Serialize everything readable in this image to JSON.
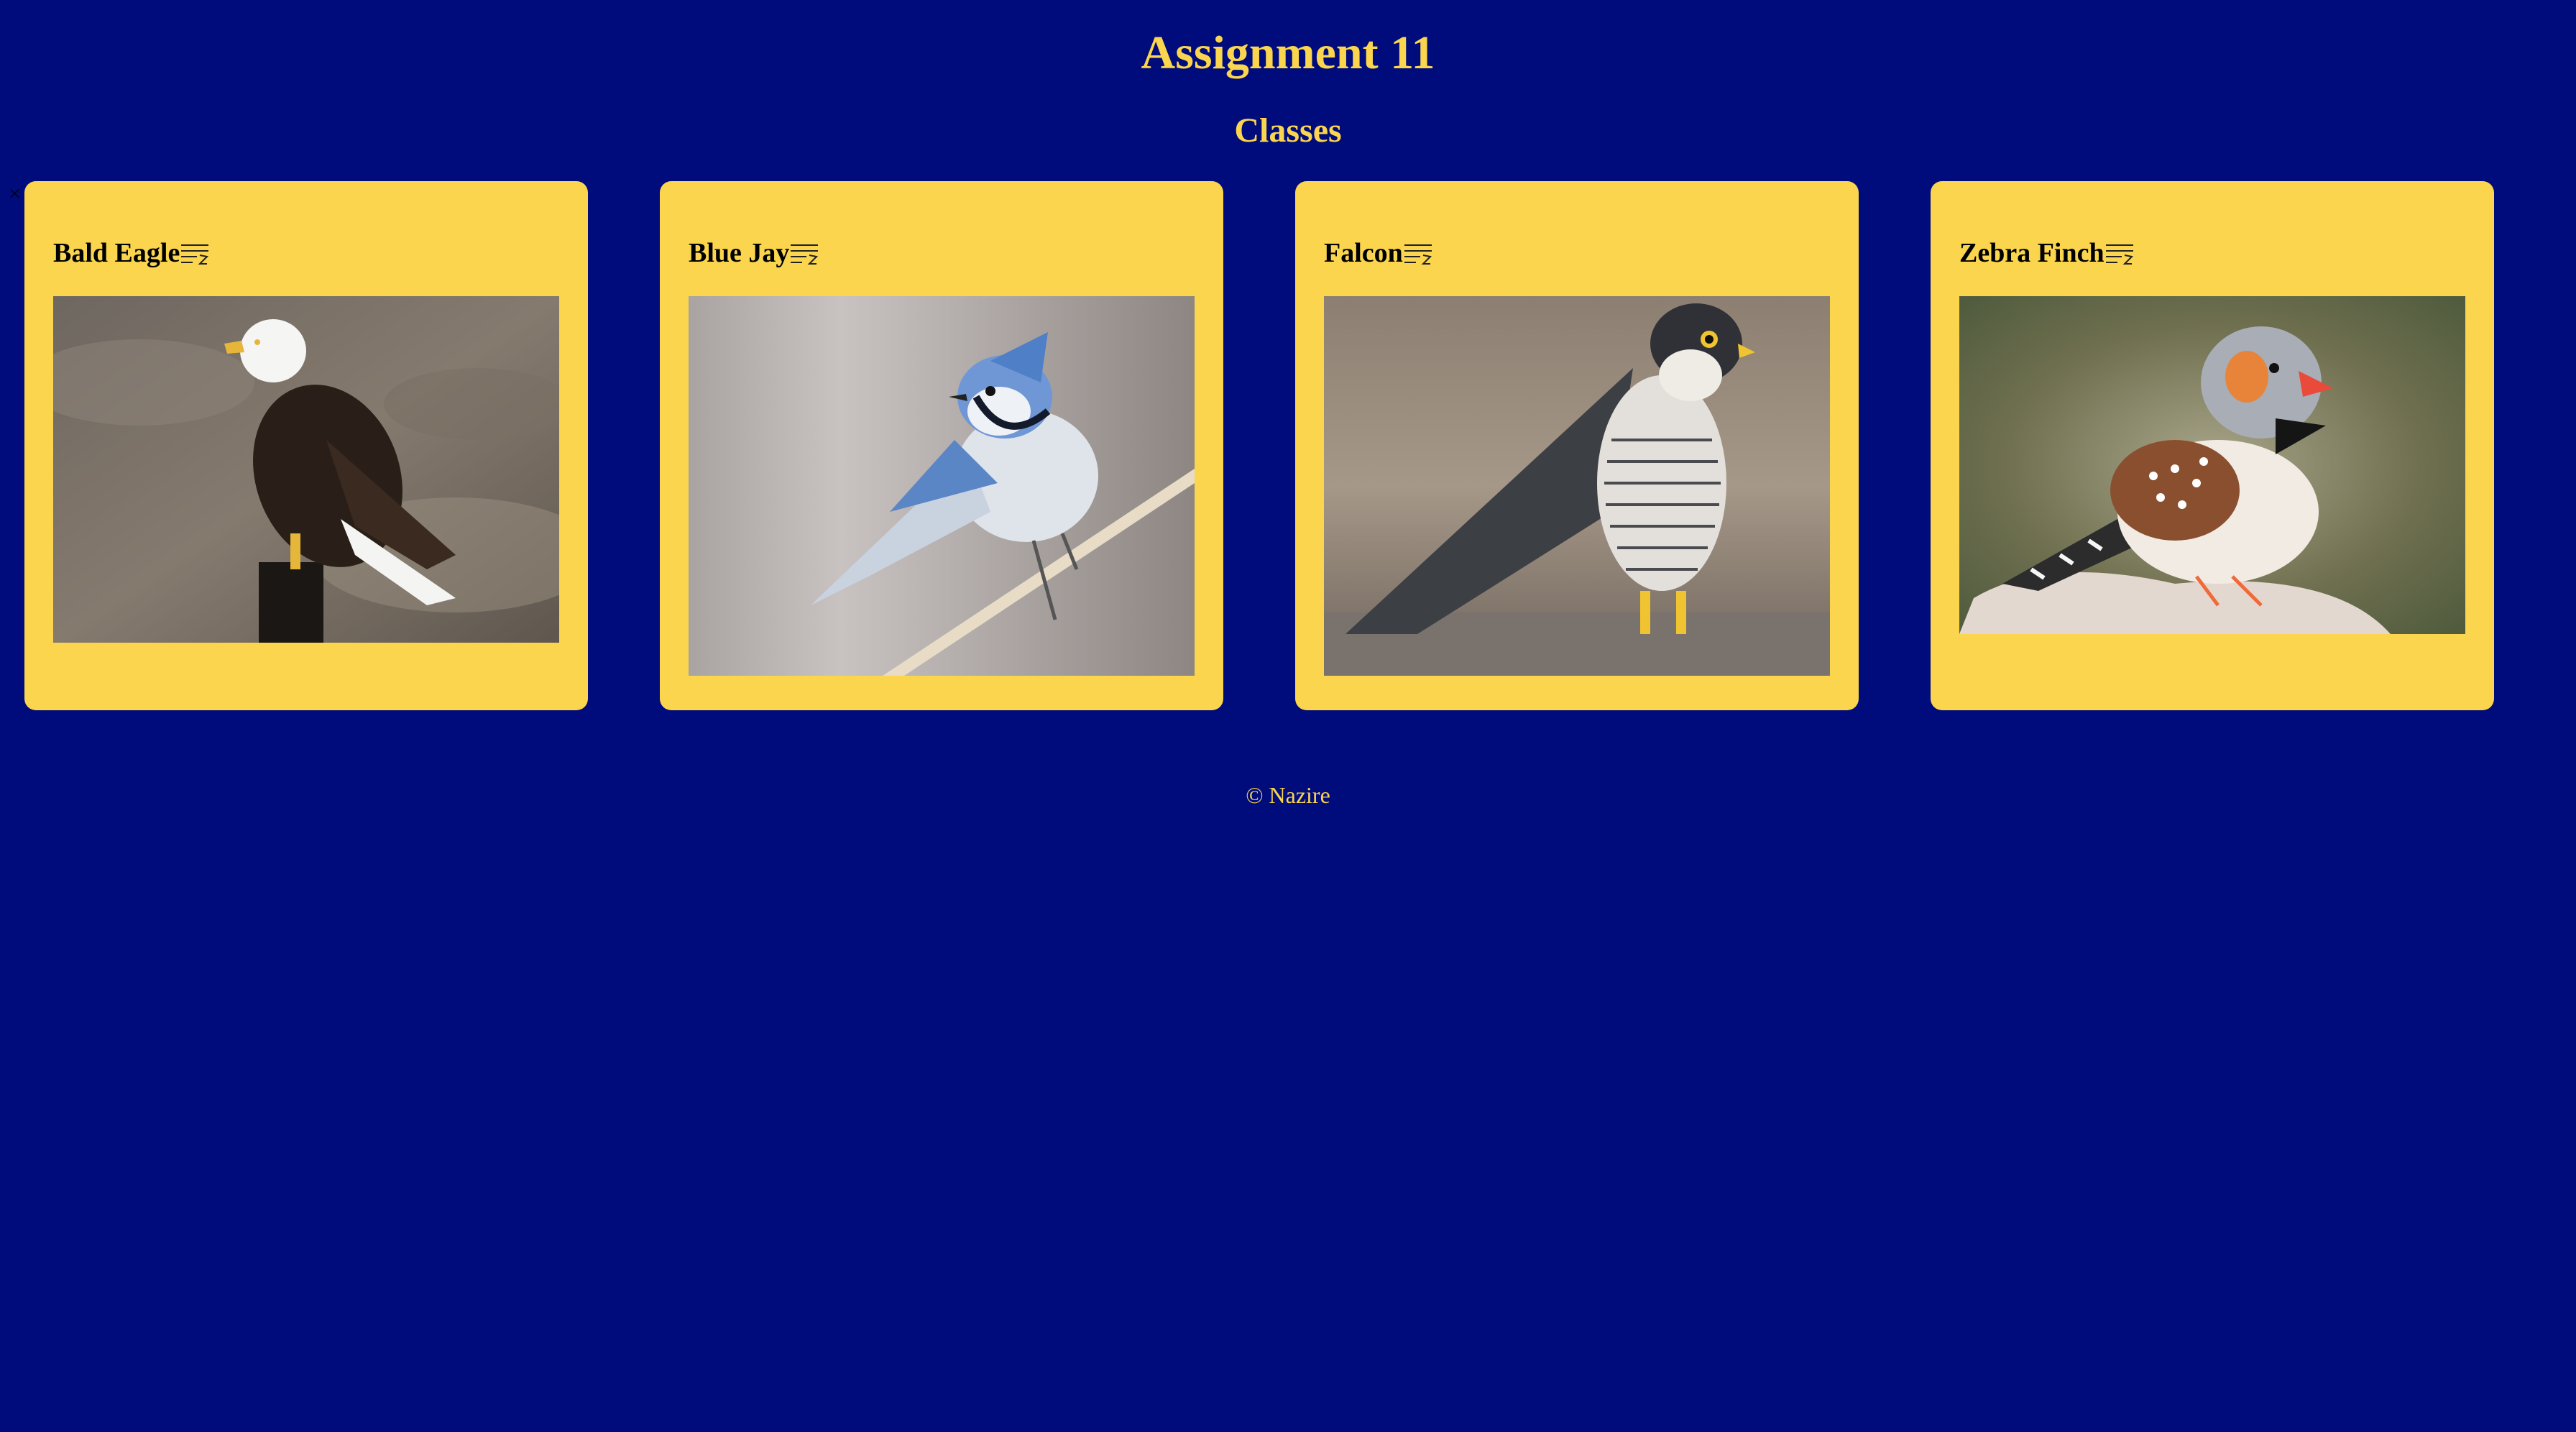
{
  "header": {
    "title": "Assignment 11",
    "subtitle": "Classes"
  },
  "toolbar": {
    "close_glyph": "×"
  },
  "cards": [
    {
      "name": "Bald Eagle",
      "photo_alt": "Bald Eagle"
    },
    {
      "name": "Blue Jay",
      "photo_alt": "Blue Jay"
    },
    {
      "name": "Falcon",
      "photo_alt": "Falcon"
    },
    {
      "name": "Zebra Finch",
      "photo_alt": "Zebra Finch"
    }
  ],
  "footer": {
    "text": "© Nazire"
  },
  "colors": {
    "background": "#000c7b",
    "accent": "#fad54d",
    "text_dark": "#000000"
  },
  "icons": {
    "close": "close-icon",
    "card_menu": "menu-icon"
  }
}
